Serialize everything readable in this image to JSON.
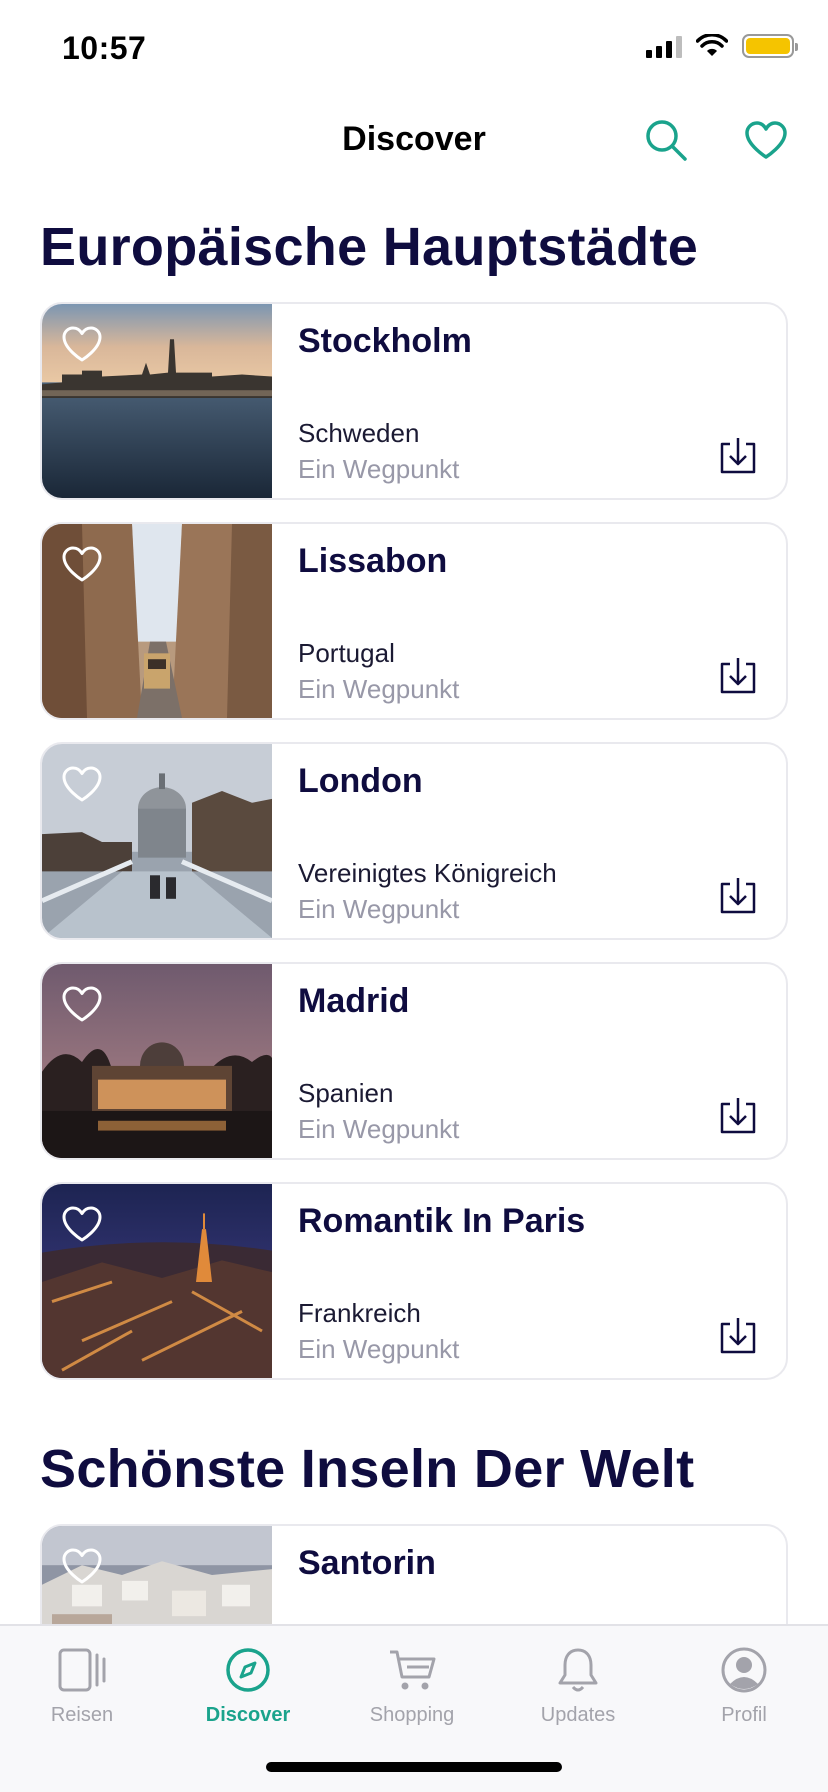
{
  "status_bar": {
    "time": "10:57",
    "battery_color": "#f5c400"
  },
  "nav": {
    "title": "Discover",
    "search_icon": "search-icon",
    "favorites_icon": "heart-icon",
    "accent_color": "#1aa38c"
  },
  "sections": [
    {
      "title": "Europäische Hauptstädte",
      "cards": [
        {
          "title": "Stockholm",
          "country": "Schweden",
          "waypoints": "Ein Wegpunkt"
        },
        {
          "title": "Lissabon",
          "country": "Portugal",
          "waypoints": "Ein Wegpunkt"
        },
        {
          "title": "London",
          "country": "Vereinigtes Königreich",
          "waypoints": "Ein Wegpunkt"
        },
        {
          "title": "Madrid",
          "country": "Spanien",
          "waypoints": "Ein Wegpunkt"
        },
        {
          "title": "Romantik In Paris",
          "country": "Frankreich",
          "waypoints": "Ein Wegpunkt"
        }
      ]
    },
    {
      "title": "Schönste Inseln Der Welt",
      "cards": [
        {
          "title": "Santorin"
        }
      ]
    }
  ],
  "tab_bar": {
    "active": "Discover",
    "tabs": [
      {
        "label": "Reisen",
        "icon": "tablet-icon"
      },
      {
        "label": "Discover",
        "icon": "compass-icon"
      },
      {
        "label": "Shopping",
        "icon": "cart-icon"
      },
      {
        "label": "Updates",
        "icon": "bell-icon"
      },
      {
        "label": "Profil",
        "icon": "profile-icon"
      }
    ]
  }
}
